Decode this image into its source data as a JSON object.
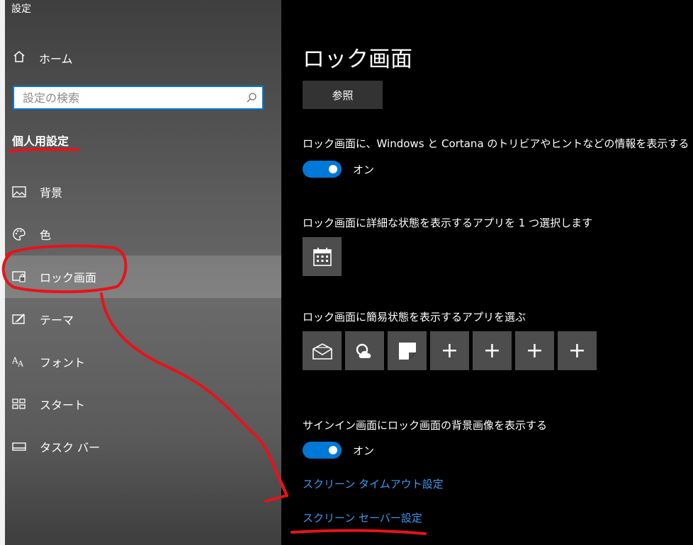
{
  "window": {
    "title": "設定"
  },
  "sidebar": {
    "home_label": "ホーム",
    "search_placeholder": "設定の検索",
    "section_title": "個人用設定",
    "items": [
      {
        "label": "背景",
        "icon": "image-icon"
      },
      {
        "label": "色",
        "icon": "palette-icon"
      },
      {
        "label": "ロック画面",
        "icon": "lock-screen-icon",
        "active": true
      },
      {
        "label": "テーマ",
        "icon": "theme-icon"
      },
      {
        "label": "フォント",
        "icon": "font-icon"
      },
      {
        "label": "スタート",
        "icon": "start-icon"
      },
      {
        "label": "タスク バー",
        "icon": "taskbar-icon"
      }
    ]
  },
  "main": {
    "title": "ロック画面",
    "browse_label": "参照",
    "fun_facts": {
      "label": "ロック画面に、Windows と Cortana のトリビアやヒントなどの情報を表示する",
      "state": "オン"
    },
    "detailed_status": {
      "label": "ロック画面に詳細な状態を表示するアプリを 1 つ選択します",
      "icon": "calendar-icon"
    },
    "quick_status": {
      "label": "ロック画面に簡易状態を表示するアプリを選ぶ",
      "apps": [
        "mail-icon",
        "weather-icon",
        "sticky-notes-icon"
      ],
      "plus": [
        "+",
        "+",
        "+",
        "+"
      ]
    },
    "signin_background": {
      "label": "サインイン画面にロック画面の背景画像を表示する",
      "state": "オン"
    },
    "links": {
      "timeout": "スクリーン タイムアウト設定",
      "screensaver": "スクリーン セーバー設定"
    }
  },
  "colors": {
    "accent": "#0078d7",
    "link": "#3a9bf0",
    "annotation": "#e8121b"
  }
}
